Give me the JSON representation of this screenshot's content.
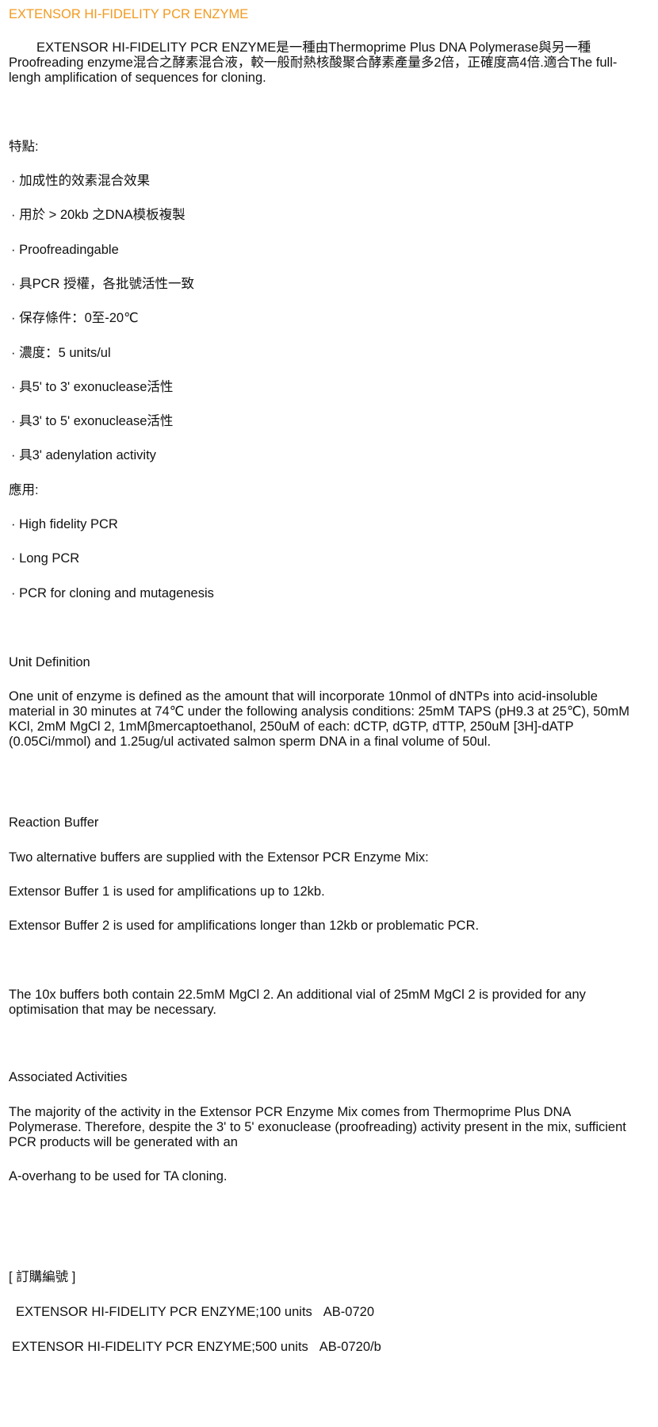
{
  "title": "EXTENSOR HI-FIDELITY PCR ENZYME",
  "intro": "EXTENSOR HI-FIDELITY PCR ENZYME是一種由Thermoprime Plus DNA Polymerase與另一種Proofreading enzyme混合之酵素混合液，較一般耐熱核酸聚合酵素產量多2倍，正確度高4倍.適合The full-lengh amplification of sequences for cloning.",
  "features": {
    "heading": "特點:",
    "items": [
      "· 加成性的效素混合效果",
      "· 用於 > 20kb 之DNA模板複製",
      "· Proofreadingable",
      "· 具PCR 授權，各批號活性一致",
      "· 保存條件：0至-20℃",
      "· 濃度：5 units/ul",
      "· 具5' to 3' exonuclease活性",
      "· 具3' to 5' exonuclease活性",
      "· 具3' adenylation activity"
    ]
  },
  "applications": {
    "heading": "應用:",
    "items": [
      "· High fidelity PCR",
      "· Long PCR",
      "· PCR for cloning and mutagenesis"
    ]
  },
  "unit_definition": {
    "heading": "Unit Definition",
    "text": "One unit of enzyme is defined as the amount that will incorporate 10nmol of dNTPs into acid-insoluble material in 30 minutes at 74℃ under the following analysis conditions: 25mM TAPS (pH9.3 at 25℃), 50mM KCl, 2mM MgCl 2, 1mMβmercaptoethanol, 250uM of each: dCTP, dGTP, dTTP, 250uM [3H]-dATP (0.05Ci/mmol) and 1.25ug/ul activated salmon sperm DNA in a final volume of 50ul."
  },
  "reaction_buffer": {
    "heading": "Reaction Buffer",
    "p1": "Two alternative buffers are supplied with the Extensor PCR Enzyme Mix:",
    "p2": "Extensor Buffer 1 is used for amplifications up to 12kb.",
    "p3": "Extensor Buffer 2 is used for amplifications longer than 12kb or problematic PCR.",
    "p4": "The 10x buffers both contain 22.5mM MgCl 2. An additional vial of 25mM MgCl 2 is provided for any optimisation that may be necessary."
  },
  "associated": {
    "heading": "Associated Activities",
    "p1": "The majority of the activity in the Extensor PCR Enzyme Mix comes from Thermoprime Plus DNA Polymerase. Therefore, despite the 3' to 5' exonuclease (proofreading) activity present in the mix, sufficient PCR products will be generated with an",
    "p2": "A-overhang to be used for TA cloning."
  },
  "order": {
    "heading": "[ 訂購編號 ]",
    "rows": [
      {
        "name": "EXTENSOR HI-FIDELITY PCR ENZYME;100 units",
        "code": "AB-0720"
      },
      {
        "name": "EXTENSOR HI-FIDELITY PCR ENZYME;500 units",
        "code": "AB-0720/b"
      }
    ]
  },
  "colors": {
    "title": "#f39a1e",
    "text": "#111111"
  }
}
